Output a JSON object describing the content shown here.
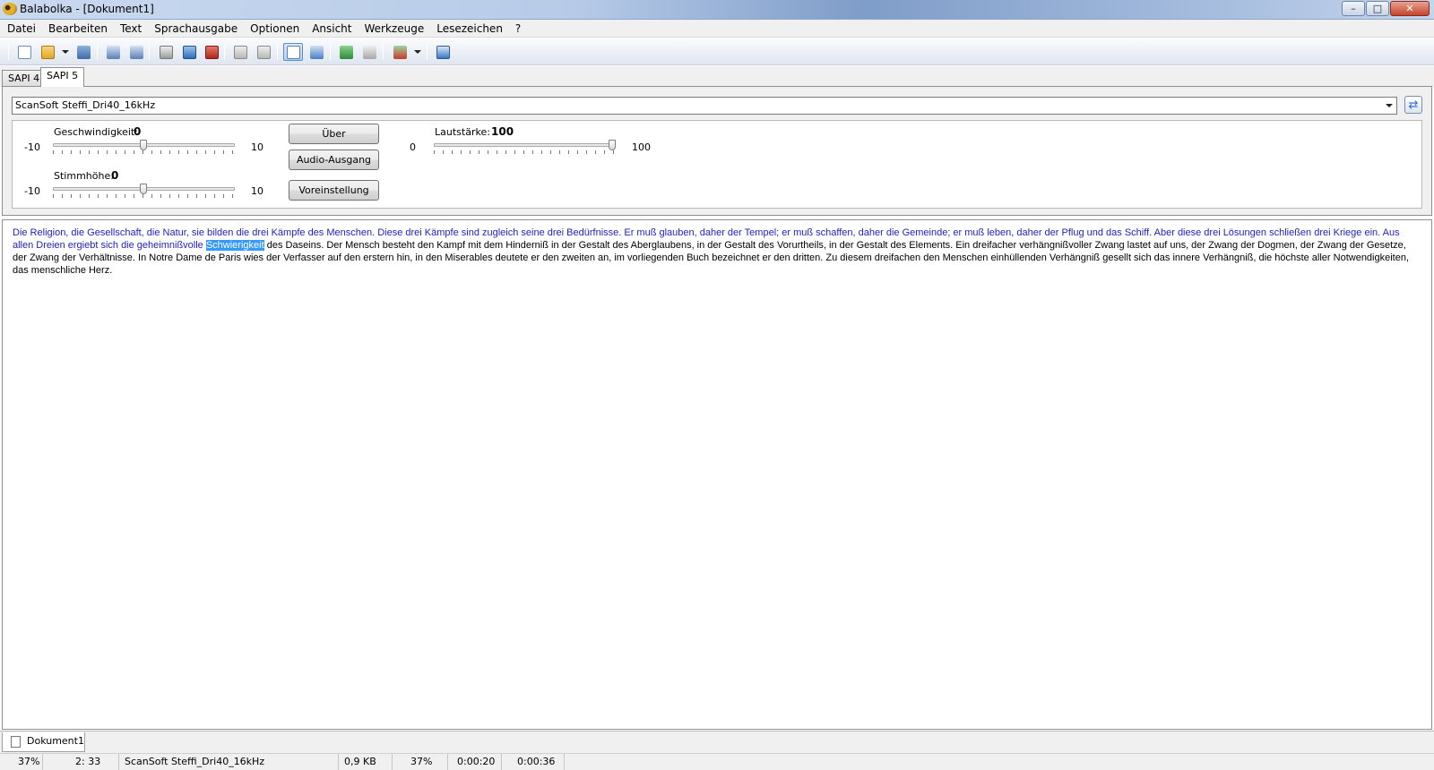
{
  "window": {
    "title": "Balabolka - [Dokument1]",
    "minimize": "–",
    "maximize": "□",
    "close": "✕"
  },
  "menu": [
    "Datei",
    "Bearbeiten",
    "Text",
    "Sprachausgabe",
    "Optionen",
    "Ansicht",
    "Werkzeuge",
    "Lesezeichen",
    "?"
  ],
  "toolbar_icons": [
    "new-document-icon",
    "open-folder-icon",
    "dropdown-arrow-icon",
    "save-icon",
    "print-icon",
    "print-preview-icon",
    "play-icon",
    "pause-icon",
    "stop-icon",
    "clipboard-read-icon",
    "clipboard-monitor-icon",
    "edit-mode-icon",
    "spell-check-icon",
    "export-icon",
    "import-icon",
    "audio-file-icon",
    "dropdown-arrow-icon",
    "help-icon"
  ],
  "tabs": [
    "SAPI 4",
    "SAPI 5"
  ],
  "voice": {
    "selected": "ScanSoft Steffi_Dri40_16kHz"
  },
  "controls": {
    "speed_label": "Geschwindigkeit:",
    "speed_value": "0",
    "speed_min": "-10",
    "speed_max": "10",
    "pitch_label": "Stimmhöhe:",
    "pitch_value": "0",
    "pitch_min": "-10",
    "pitch_max": "10",
    "volume_label": "Lautstärke:",
    "volume_value": "100",
    "volume_min": "0",
    "volume_max": "100",
    "about_button": "Über",
    "audio_output_button": "Audio-Ausgang",
    "preset_button": "Voreinstellung"
  },
  "document": {
    "read_part": "Die Religion, die Gesellschaft, die Natur, sie bilden die drei Kämpfe des Menschen. Diese drei Kämpfe sind zugleich seine drei Bedürfnisse. Er muß glauben, daher der Tempel; er muß schaffen, daher die Gemeinde; er muß leben, daher der Pflug und das Schiff. Aber diese drei Lösungen schließen drei Kriege ein. Aus allen Dreien ergiebt sich die geheimnißvolle ",
    "current_word": "Schwierigkeit",
    "rest": " des Daseins. Der Mensch besteht den Kampf mit dem Hinderniß in der Gestalt des Aberglaubens, in der Gestalt des Vorurtheils, in der Gestalt des Elements. Ein dreifacher verhängnißvoller Zwang lastet auf uns, der Zwang der Dogmen, der Zwang der Gesetze, der Zwang der Verhältnisse. In Notre Dame de Paris wies der Verfasser auf den erstern hin, in den Miserables deutete er den zweiten an, im vorliegenden Buch bezeichnet er den dritten. Zu diesem dreifachen den Menschen einhüllenden Verhängniß gesellt sich das innere Verhängniß, die höchste aller Notwendigkeiten, das menschliche Herz."
  },
  "doc_tab": "Dokument1",
  "status": {
    "progress": "37%",
    "position": "2:  33",
    "voice": "ScanSoft Steffi_Dri40_16kHz",
    "size": "0,9 KB",
    "percent": "37%",
    "elapsed": "0:00:20",
    "total": "0:00:36"
  },
  "colors": {
    "read_text": "#1f1fbf",
    "highlight": "#3399ff",
    "stop_icon": "#c0281e"
  }
}
